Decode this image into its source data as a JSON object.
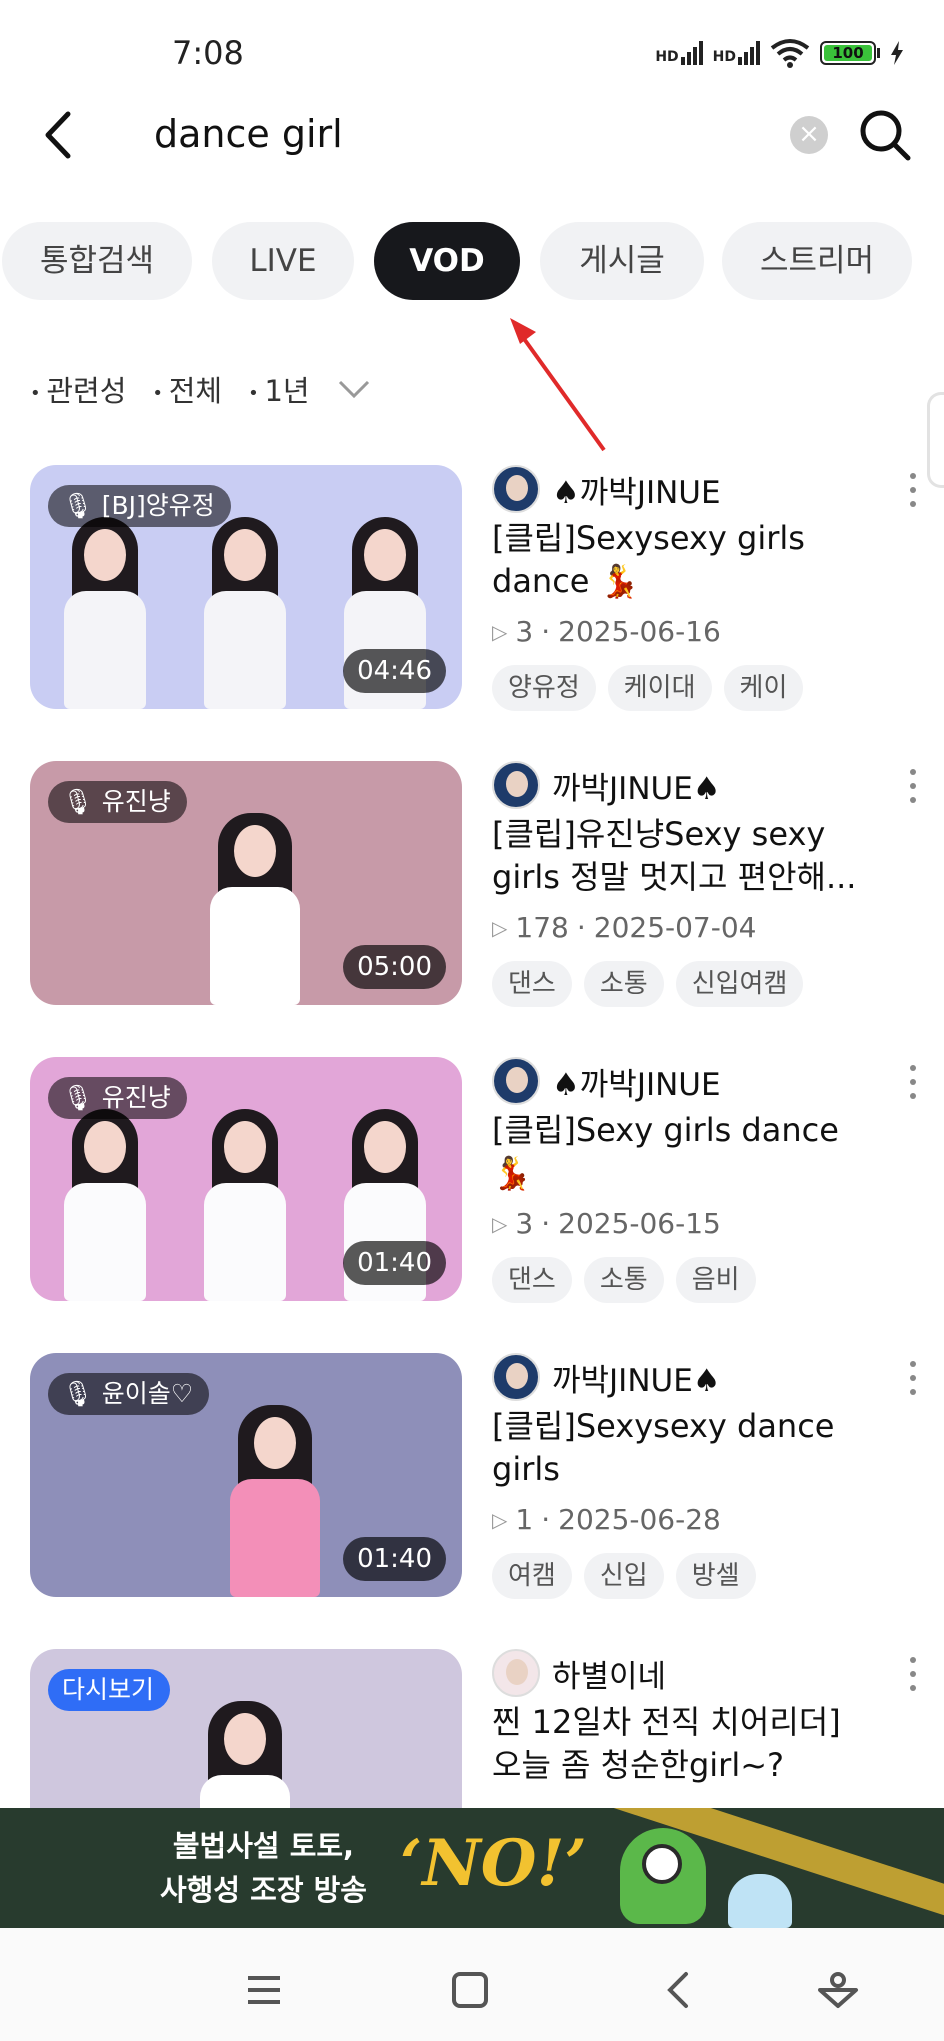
{
  "status_bar": {
    "time": "7:08",
    "signal1_label": "HD",
    "signal2_label": "HD",
    "battery": "100"
  },
  "search": {
    "query": "dance girl",
    "icons": [
      "back-arrow-icon",
      "clear-icon",
      "search-icon"
    ]
  },
  "tabs": [
    {
      "label": "통합검색",
      "active": false
    },
    {
      "label": "LIVE",
      "active": false
    },
    {
      "label": "VOD",
      "active": true
    },
    {
      "label": "게시글",
      "active": false
    },
    {
      "label": "스트리머",
      "active": false
    }
  ],
  "filters": [
    "관련성",
    "전체",
    "1년"
  ],
  "results": [
    {
      "thumb_badge": "[BJ]양유정",
      "badge_type": "mic",
      "duration": "04:46",
      "channel": "♠까박JINUE",
      "title": "[클립]Sexysexy girls dance 💃",
      "views": "3",
      "date": "2025-06-16",
      "tags": [
        "양유정",
        "케이대",
        "케이"
      ],
      "colors": {
        "bg": "#c9cdf3",
        "dress": "#f4f4f8"
      }
    },
    {
      "thumb_badge": "유진냥",
      "badge_type": "mic",
      "duration": "05:00",
      "channel": "까박JINUE♠",
      "title": "[클립]유진냥Sexy sexy girls 정말 멋지고 편안해...",
      "views": "178",
      "date": "2025-07-04",
      "tags": [
        "댄스",
        "소통",
        "신입여캠"
      ],
      "colors": {
        "bg": "#c79aa8",
        "dress": "#ffffff"
      }
    },
    {
      "thumb_badge": "유진냥",
      "badge_type": "mic",
      "duration": "01:40",
      "channel": "♠까박JINUE",
      "title": "[클립]Sexy girls dance 💃",
      "views": "3",
      "date": "2025-06-15",
      "tags": [
        "댄스",
        "소통",
        "음비"
      ],
      "colors": {
        "bg": "#e2a6d8",
        "dress": "#fbfbfd"
      }
    },
    {
      "thumb_badge": "윤이솔♡",
      "badge_type": "mic",
      "duration": "01:40",
      "channel": "까박JINUE♠",
      "title": "[클립]Sexysexy dance girls",
      "views": "1",
      "date": "2025-06-28",
      "tags": [
        "여캠",
        "신입",
        "방셀"
      ],
      "colors": {
        "bg": "#8e8fb9",
        "dress": "#f38fb8"
      }
    },
    {
      "thumb_badge": "다시보기",
      "badge_type": "replay",
      "duration": "",
      "channel": "하별이네",
      "title": "찐 12일차 전직 치어리더] 오늘 좀 청순한girl~?",
      "views": "",
      "date": "",
      "tags": [],
      "colors": {
        "bg": "#cfc7de",
        "dress": "#ffffff"
      }
    }
  ],
  "banner": {
    "line1": "불법사설 토토,",
    "line2": "사행성 조장 방송",
    "slogan": "‘NO!’"
  },
  "nav_icons": [
    "menu-icon",
    "home-icon",
    "back-icon",
    "assistant-icon"
  ]
}
